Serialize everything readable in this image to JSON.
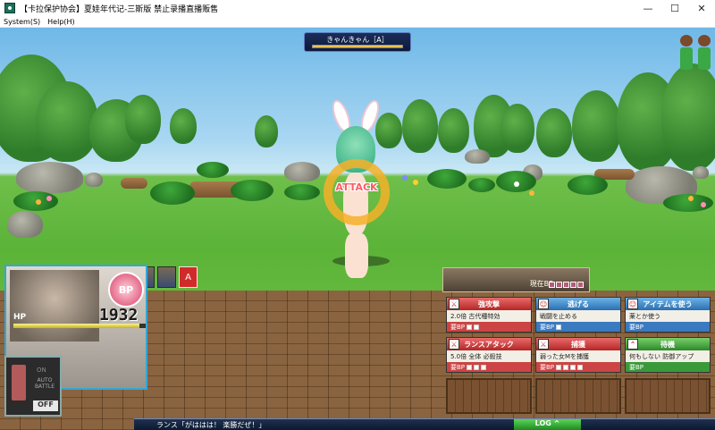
{
  "window": {
    "title": "【卡拉保护协会】夏娃年代记-三斯版 禁止录播直播贩售",
    "minimize": "—",
    "maximize": "☐",
    "close": "✕"
  },
  "menu": {
    "items": [
      {
        "label": "System(S)"
      },
      {
        "label": "Help(H)"
      }
    ]
  },
  "enemy": {
    "name": "きゃんきゃん［A］",
    "hp_fraction": 1.0
  },
  "target": {
    "label": "ATTACK"
  },
  "turn_order": {
    "slots": [
      "hero",
      "hero",
      "A",
      "hero",
      "hero",
      "A",
      "hero",
      "hero",
      "A"
    ]
  },
  "bp_bar": {
    "label": "現在BP",
    "cells": 5
  },
  "status": {
    "bp_badge": "BP",
    "hp_label": "HP",
    "hp_value": "1932",
    "hp_fraction": 0.95
  },
  "auto_battle": {
    "on_label": "ON",
    "auto_label": "AUTO BATTLE",
    "off_label": "OFF"
  },
  "commands": [
    {
      "title": "強攻撃",
      "desc": "2.0倍 古代種特効",
      "cost_label": "要BP",
      "pips": 2,
      "color": "red",
      "icon": "sword-icon"
    },
    {
      "title": "逃げる",
      "desc": "戦闘を止める",
      "cost_label": "要BP",
      "pips": 1,
      "color": "blue",
      "icon": "person-icon"
    },
    {
      "title": "アイテムを使う",
      "desc": "薬とか使う",
      "cost_label": "要BP",
      "pips": 0,
      "color": "blue",
      "icon": "person-icon"
    },
    {
      "title": "ランスアタック",
      "desc": "5.0倍 全体 必殺技",
      "cost_label": "要BP",
      "pips": 3,
      "color": "red",
      "icon": "sword-icon"
    },
    {
      "title": "捕獲",
      "desc": "弱った女Mを捕獲",
      "cost_label": "要BP",
      "pips": 4,
      "color": "red",
      "icon": "sword-icon"
    },
    {
      "title": "待機",
      "desc": "何もしない 防御アップ",
      "cost_label": "要BP",
      "pips": 0,
      "color": "green",
      "icon": "chevron-up-icon"
    }
  ],
  "message": {
    "text": "ランス「がははは！ 楽勝だぜ！」",
    "log_button": "LOG ^"
  },
  "colors": {
    "accent_blue": "#31a7d8",
    "command_red": "#b52626",
    "command_blue": "#2a6fb0",
    "command_green": "#2c8a2a"
  }
}
